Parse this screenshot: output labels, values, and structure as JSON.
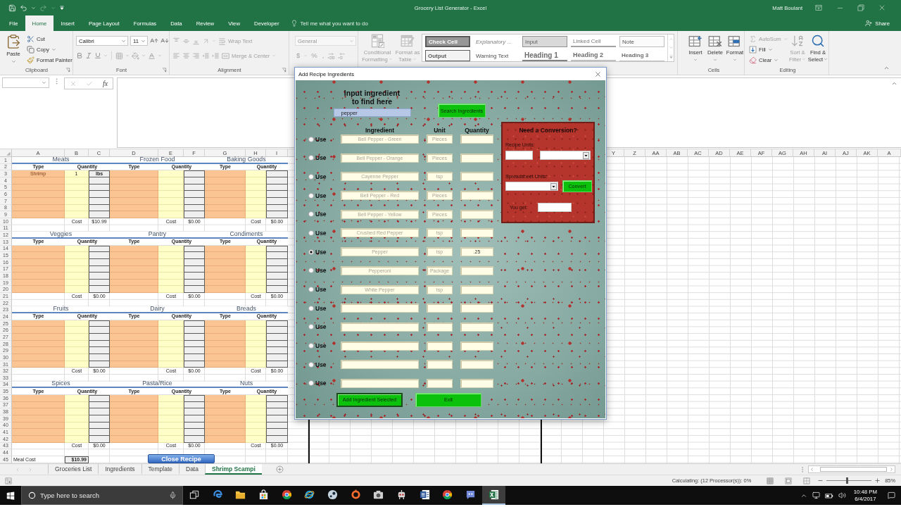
{
  "window": {
    "title": "Grocery List Generator - Excel",
    "user": "Matt Boulant"
  },
  "ribbon_tabs": [
    {
      "label": "File",
      "selected": false
    },
    {
      "label": "Home",
      "selected": true
    },
    {
      "label": "Insert",
      "selected": false
    },
    {
      "label": "Page Layout",
      "selected": false
    },
    {
      "label": "Formulas",
      "selected": false
    },
    {
      "label": "Data",
      "selected": false
    },
    {
      "label": "Review",
      "selected": false
    },
    {
      "label": "View",
      "selected": false
    },
    {
      "label": "Developer",
      "selected": false
    }
  ],
  "tell_me": {
    "placeholder": "Tell me what you want to do"
  },
  "share": "Share",
  "ribbon": {
    "clipboard": {
      "label": "Clipboard",
      "paste": "Paste",
      "cut": "Cut",
      "copy": "Copy",
      "format_painter": "Format Painter"
    },
    "font": {
      "label": "Font",
      "name": "Calibri",
      "size": "11"
    },
    "alignment": {
      "label": "Alignment",
      "disabled": true,
      "wrap_text": "Wrap Text",
      "merge_center": "Merge & Center"
    },
    "number": {
      "disabled": true,
      "format": "General",
      "currency": "$",
      "percent": "%",
      "comma": ","
    },
    "styles": {
      "disabled": true,
      "conditional_formatting": "Conditional Formatting",
      "format_as_table": "Format as Table",
      "cell_styles": [
        {
          "label": "Check Cell",
          "kind": "check"
        },
        {
          "label": "Explanatory ...",
          "kind": "explanatory"
        },
        {
          "label": "Input",
          "kind": "input"
        },
        {
          "label": "Linked Cell",
          "kind": "linked"
        },
        {
          "label": "Note",
          "kind": "note"
        },
        {
          "label": "Output",
          "kind": "output"
        },
        {
          "label": "Warning Text",
          "kind": "warning"
        },
        {
          "label": "Heading 1",
          "kind": "heading1"
        },
        {
          "label": "Heading 2",
          "kind": "heading2"
        },
        {
          "label": "Heading 3",
          "kind": "heading3"
        }
      ]
    },
    "cells": {
      "label": "Cells",
      "buttons": [
        "Insert",
        "Delete",
        "Format"
      ]
    },
    "editing": {
      "label": "Editing",
      "autosum": {
        "label": "AutoSum",
        "disabled": true
      },
      "fill": {
        "label": "Fill",
        "disabled": false
      },
      "clear": {
        "label": "Clear",
        "disabled": false
      },
      "sort_filter": {
        "label": "Sort & Filter",
        "disabled": true
      },
      "find_select": {
        "label": "Find & Select",
        "disabled": false
      }
    }
  },
  "formula_bar": {
    "function_label": "fx"
  },
  "sheet": {
    "columns": [
      "A",
      "B",
      "C",
      "D",
      "E",
      "F",
      "G",
      "H",
      "I"
    ],
    "right_columns": [
      "Y",
      "Z",
      "AA",
      "AB",
      "AC",
      "AD",
      "AE",
      "AF",
      "AG",
      "AH",
      "AI",
      "AJ",
      "AK",
      "A"
    ],
    "row_numbers": [
      "1",
      "2",
      "3",
      "4",
      "5",
      "6",
      "7",
      "8",
      "9",
      "10",
      "11",
      "12",
      "13",
      "14",
      "15",
      "16",
      "17",
      "18",
      "19",
      "20",
      "21",
      "22",
      "23",
      "24",
      "25",
      "26",
      "27",
      "28",
      "29",
      "30",
      "31",
      "32",
      "33",
      "34",
      "35",
      "36",
      "37",
      "38",
      "39",
      "40",
      "41",
      "42",
      "43",
      "44",
      "45"
    ],
    "bands": [
      {
        "categories": [
          {
            "title": "Meats",
            "type_header": "Type",
            "quantity_header": "Quantity",
            "items": [
              {
                "type": "Shrimp",
                "quantity": "1",
                "unit": "lbs"
              }
            ],
            "cost_label": "Cost",
            "cost": "$10.99"
          },
          {
            "title": "Frozen Food",
            "type_header": "Type",
            "quantity_header": "Quantity",
            "cost_label": "Cost",
            "cost": "$0.00"
          },
          {
            "title": "Baking Goods",
            "type_header": "Type",
            "quantity_header": "Quantity",
            "cost_label": "Cost",
            "cost": "$0.00"
          }
        ]
      },
      {
        "categories": [
          {
            "title": "Veggies",
            "type_header": "Type",
            "quantity_header": "Quantity",
            "cost_label": "Cost",
            "cost": "$0.00"
          },
          {
            "title": "Pantry",
            "type_header": "Type",
            "quantity_header": "Quantity",
            "cost_label": "Cost",
            "cost": "$0.00"
          },
          {
            "title": "Condiments",
            "type_header": "Type",
            "quantity_header": "Quantity",
            "cost_label": "Cost",
            "cost": "$0.00"
          }
        ]
      },
      {
        "categories": [
          {
            "title": "Fruits",
            "type_header": "Type",
            "quantity_header": "Quantity",
            "cost_label": "Cost",
            "cost": "$0.00"
          },
          {
            "title": "Dairy",
            "type_header": "Type",
            "quantity_header": "Quantity",
            "cost_label": "Cost",
            "cost": "$0.00"
          },
          {
            "title": "Breads",
            "type_header": "Type",
            "quantity_header": "Quantity",
            "cost_label": "Cost",
            "cost": "$0.00"
          }
        ]
      },
      {
        "categories": [
          {
            "title": "Spices",
            "type_header": "Type",
            "quantity_header": "Quantity",
            "cost_label": "Cost",
            "cost": "$0.00"
          },
          {
            "title": "Pasta/Rice",
            "type_header": "Type",
            "quantity_header": "Quantity",
            "cost_label": "Cost",
            "cost": "$0.00"
          },
          {
            "title": "Nuts",
            "type_header": "Type",
            "quantity_header": "Quantity",
            "cost_label": "Cost",
            "cost": "$0.00"
          }
        ]
      }
    ],
    "meal_cost": {
      "label": "Meal Cost",
      "value": "$10.99"
    },
    "close_button": "Close Recipe"
  },
  "sheet_tabs": [
    {
      "label": "Groceries List",
      "selected": false
    },
    {
      "label": "Ingredients",
      "selected": false
    },
    {
      "label": "Template",
      "selected": false
    },
    {
      "label": "Data",
      "selected": false
    },
    {
      "label": "Shrimp Scampi",
      "selected": true
    }
  ],
  "status_bar": {
    "status": "Calculating: (12 Processor(s)): 0%",
    "zoom_slider": {
      "level": 0.45
    },
    "zoom": "85%"
  },
  "taskbar": {
    "search": {
      "placeholder": "Type here to search"
    },
    "apps": [
      {
        "kind": "taskview",
        "selected": false
      },
      {
        "kind": "swirl",
        "selected": false
      },
      {
        "kind": "folder",
        "selected": false
      },
      {
        "kind": "bag",
        "selected": false
      },
      {
        "kind": "wheel",
        "selected": false
      },
      {
        "kind": "globe",
        "selected": false
      },
      {
        "kind": "disc",
        "selected": false
      },
      {
        "kind": "ring",
        "selected": false
      },
      {
        "kind": "camera",
        "selected": false
      },
      {
        "kind": "robot",
        "selected": false
      },
      {
        "kind": "document",
        "selected": false
      },
      {
        "kind": "wheel",
        "selected": false
      },
      {
        "kind": "chat",
        "selected": false
      },
      {
        "kind": "sheet",
        "selected": true
      }
    ],
    "time": "10:48 PM",
    "date": "6/4/2017"
  },
  "dialog": {
    "title": "Add Recipe Ingredients",
    "search_label": "Input ingredient to find here",
    "search_value": "pepper",
    "search_button": "Search Ingredients",
    "columns": [
      "Ingredient",
      "Unit",
      "Quantity"
    ],
    "rows": [
      {
        "label": "Use",
        "selected": false,
        "ingredient": "Bell Pepper - Green",
        "unit": "Pieces"
      },
      {
        "label": "Use",
        "selected": false,
        "ingredient": "Bell Pepper - Orange",
        "unit": "Pieces"
      },
      {
        "label": "Use",
        "selected": false,
        "ingredient": "Cayenne Pepper",
        "unit": "tsp"
      },
      {
        "label": "Use",
        "selected": false,
        "ingredient": "Bell Pepper - Red",
        "unit": "Pieces"
      },
      {
        "label": "Use",
        "selected": false,
        "ingredient": "Bell Pepper - Yellow",
        "unit": "Pieces"
      },
      {
        "label": "Use",
        "selected": false,
        "ingredient": "Crushed Red Pepper",
        "unit": "tsp"
      },
      {
        "label": "Use",
        "selected": true,
        "ingredient": "Pepper",
        "unit": "tsp",
        "quantity": ".25"
      },
      {
        "label": "Use",
        "selected": false,
        "ingredient": "Pepperoni",
        "unit": "Package"
      },
      {
        "label": "Use",
        "selected": false,
        "ingredient": "White Pepper",
        "unit": "tsp"
      },
      {
        "label": "Use",
        "selected": false
      },
      {
        "label": "Use",
        "selected": false
      },
      {
        "label": "Use",
        "selected": false
      },
      {
        "label": "Use",
        "selected": false
      },
      {
        "label": "Use",
        "selected": false
      }
    ],
    "buttons": [
      {
        "label": "Add Ingredient Selected",
        "focused": true
      },
      {
        "label": "Exit",
        "focused": false
      }
    ],
    "conversion": {
      "title": "Need a Conversion?",
      "recipe_units_label": "Recipe Units:",
      "spreadsheet_units_label": "Spreadsheet Units:",
      "convert_button": "Convert",
      "result_label": "You get:"
    }
  }
}
